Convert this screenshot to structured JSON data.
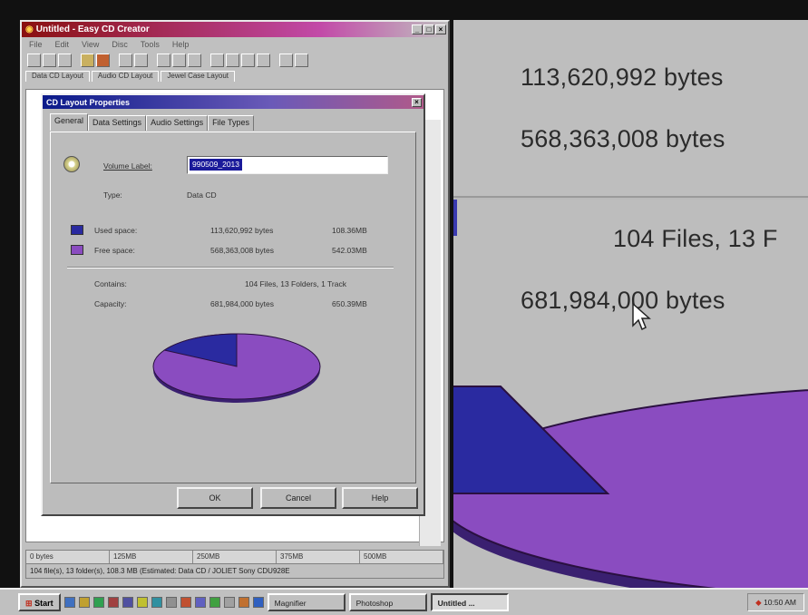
{
  "app": {
    "title": "Untitled - Easy CD Creator",
    "menu": [
      "File",
      "Edit",
      "View",
      "Disc",
      "Tools",
      "Help"
    ],
    "doc_tabs": [
      "Data CD Layout",
      "Audio CD Layout",
      "Jewel Case Layout"
    ],
    "ruler": [
      "0 bytes",
      "125MB",
      "250MB",
      "375MB",
      "500MB"
    ],
    "status": "104 file(s), 13 folder(s), 108.3 MB (Estimated: Data CD / JOLIET  Sony CDU928E"
  },
  "dialog": {
    "title": "CD Layout Properties",
    "tabs": [
      "General",
      "Data Settings",
      "Audio Settings",
      "File Types"
    ],
    "volume_label_caption": "Volume Label:",
    "volume_label_value": "990509_2013",
    "type_caption": "Type:",
    "type_value": "Data CD",
    "used_caption": "Used space:",
    "used_bytes": "113,620,992 bytes",
    "used_mb": "108.36MB",
    "free_caption": "Free space:",
    "free_bytes": "568,363,008 bytes",
    "free_mb": "542.03MB",
    "contains_caption": "Contains:",
    "contains_value": "104 Files, 13 Folders, 1 Track",
    "capacity_caption": "Capacity:",
    "capacity_bytes": "681,984,000 bytes",
    "capacity_mb": "650.39MB",
    "ok": "OK",
    "cancel": "Cancel",
    "help": "Help",
    "used_color": "#2a2aa0",
    "free_color": "#8a4cc0",
    "used_fraction": 0.1666
  },
  "magnifier": {
    "used_bytes": "113,620,992 bytes",
    "free_bytes": "568,363,008 bytes",
    "contains": "104 Files, 13 F",
    "capacity": "681,984,000 bytes"
  },
  "taskbar": {
    "start": "Start",
    "tasks": [
      "Magnifier",
      "Photoshop",
      "Untitled ..."
    ],
    "clock": "10:50 AM"
  }
}
